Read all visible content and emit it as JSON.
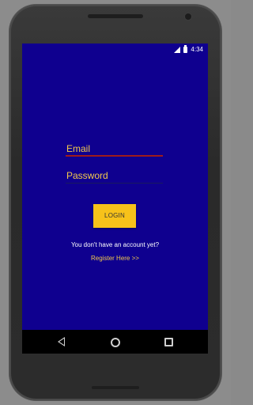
{
  "status_bar": {
    "time": "4:34"
  },
  "login_form": {
    "email_label": "Email",
    "password_label": "Password",
    "login_button": "LOGIN",
    "no_account_text": "You don't have an account yet?",
    "register_link": "Register Here >>"
  },
  "colors": {
    "screen_background": "#0f008f",
    "accent_yellow": "#f7c21a",
    "label_yellow": "#f2c94c",
    "email_underline": "#9e1b1b"
  },
  "icons": {
    "status": [
      "signal-icon",
      "battery-icon"
    ],
    "navigation": [
      "back-icon",
      "home-icon",
      "recents-icon"
    ]
  }
}
